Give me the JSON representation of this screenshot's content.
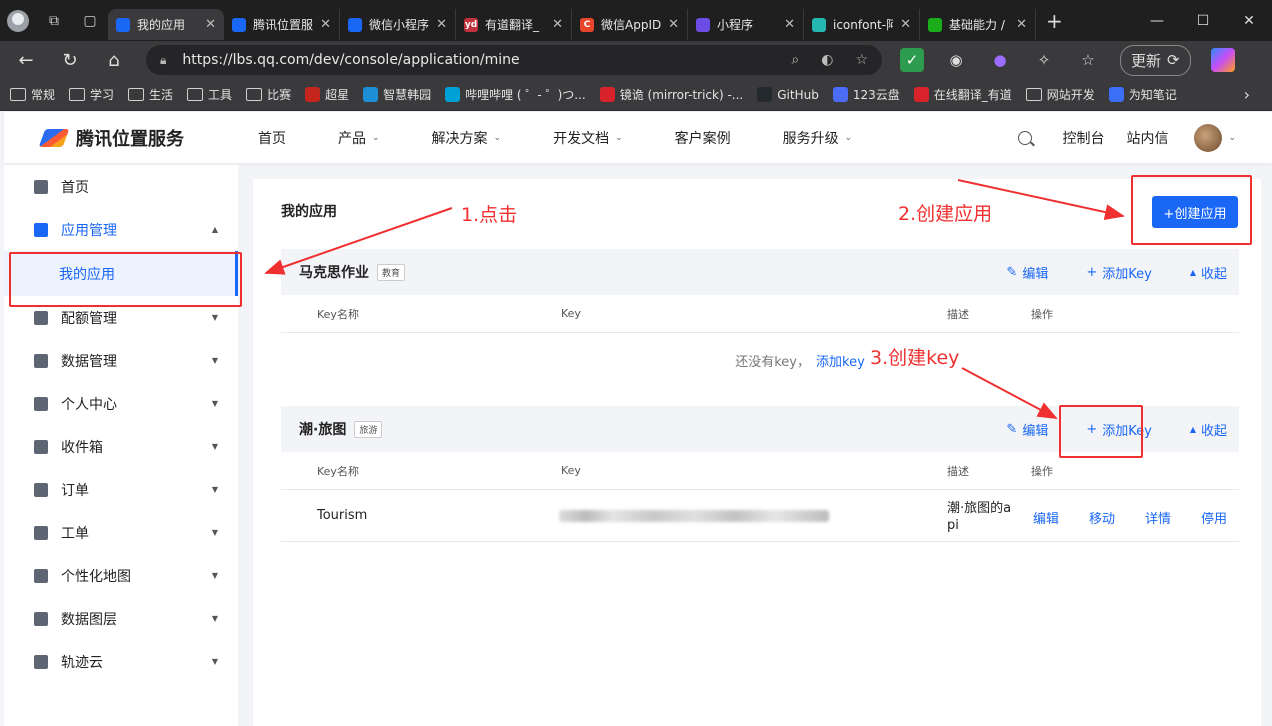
{
  "browser": {
    "tabs": [
      {
        "title": "我的应用",
        "fav_color": "#1a67f5",
        "active": true
      },
      {
        "title": "腾讯位置服",
        "fav_color": "#1a67f5",
        "active": false
      },
      {
        "title": "微信小程序",
        "fav_color": "#1a67f5",
        "active": false
      },
      {
        "title": "有道翻译_",
        "fav_color": "#c0313b",
        "fav_text": "yd",
        "active": false
      },
      {
        "title": "微信AppID",
        "fav_color": "#e8452b",
        "fav_text": "C",
        "active": false
      },
      {
        "title": "小程序",
        "fav_color": "#6b4de6",
        "active": false
      },
      {
        "title": "iconfont-阿",
        "fav_color": "#25b8b0",
        "active": false
      },
      {
        "title": "基础能力 /",
        "fav_color": "#1aad19",
        "active": false
      }
    ],
    "url": "https://lbs.qq.com/dev/console/application/mine",
    "update_label": "更新",
    "bookmarks": [
      {
        "label": "常规",
        "type": "folder"
      },
      {
        "label": "学习",
        "type": "folder"
      },
      {
        "label": "生活",
        "type": "folder"
      },
      {
        "label": "工具",
        "type": "folder"
      },
      {
        "label": "比赛",
        "type": "folder"
      },
      {
        "label": "超星",
        "type": "icon",
        "color": "#c4261d"
      },
      {
        "label": "智慧韩园",
        "type": "icon",
        "color": "#1d8fd6"
      },
      {
        "label": "哔哩哔哩 ( ゜- ゜)つ...",
        "type": "icon",
        "color": "#00a1d6"
      },
      {
        "label": "镜诡 (mirror-trick) -...",
        "type": "icon",
        "color": "#d8232a"
      },
      {
        "label": "GitHub",
        "type": "icon",
        "color": "#24292e"
      },
      {
        "label": "123云盘",
        "type": "icon",
        "color": "#4a6cf7"
      },
      {
        "label": "在线翻译_有道",
        "type": "icon",
        "color": "#d8232a"
      },
      {
        "label": "网站开发",
        "type": "folder"
      },
      {
        "label": "为知笔记",
        "type": "icon",
        "color": "#3c6ff7"
      }
    ]
  },
  "site": {
    "logo_text": "腾讯位置服务",
    "menu": [
      {
        "label": "首页",
        "dropdown": false
      },
      {
        "label": "产品",
        "dropdown": true
      },
      {
        "label": "解决方案",
        "dropdown": true
      },
      {
        "label": "开发文档",
        "dropdown": true
      },
      {
        "label": "客户案例",
        "dropdown": false
      },
      {
        "label": "服务升级",
        "dropdown": true
      }
    ],
    "console_label": "控制台",
    "messages_label": "站内信"
  },
  "sidebar": {
    "items": [
      {
        "label": "首页",
        "icon": "list-icon"
      },
      {
        "label": "应用管理",
        "icon": "grid-icon",
        "open": true
      },
      {
        "label": "我的应用",
        "sub": true
      },
      {
        "label": "配额管理",
        "icon": "chart-icon"
      },
      {
        "label": "数据管理",
        "icon": "database-icon"
      },
      {
        "label": "个人中心",
        "icon": "user-icon"
      },
      {
        "label": "收件箱",
        "icon": "mail-icon"
      },
      {
        "label": "订单",
        "icon": "clipboard-icon"
      },
      {
        "label": "工单",
        "icon": "ticket-icon"
      },
      {
        "label": "个性化地图",
        "icon": "map-style-icon"
      },
      {
        "label": "数据图层",
        "icon": "layers-icon"
      },
      {
        "label": "轨迹云",
        "icon": "track-icon"
      }
    ]
  },
  "main": {
    "title": "我的应用",
    "create_button": "+创建应用",
    "columns": [
      "Key名称",
      "Key",
      "描述",
      "操作"
    ],
    "apps": [
      {
        "name": "马克思作业",
        "tag": "教育",
        "actions": [
          "编辑",
          "添加Key",
          "收起"
        ],
        "empty_text": "还没有key，",
        "empty_link": "添加key"
      },
      {
        "name": "潮·旅图",
        "tag": "旅游",
        "actions": [
          "编辑",
          "添加Key",
          "收起"
        ],
        "rows": [
          {
            "key_name": "Tourism",
            "desc_line1": "潮·旅图的a",
            "desc_line2": "pi",
            "ops": [
              "编辑",
              "移动",
              "详情",
              "停用"
            ]
          }
        ]
      }
    ]
  },
  "annotations": {
    "step1": "1.点击",
    "step2": "2.创建应用",
    "step3": "3.创建key",
    "color": "#f03030"
  }
}
